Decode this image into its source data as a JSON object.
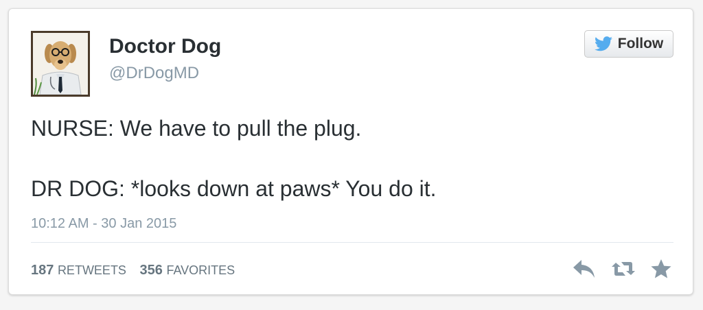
{
  "user": {
    "name": "Doctor Dog",
    "handle": "@DrDogMD"
  },
  "follow_button": {
    "label": "Follow"
  },
  "tweet": {
    "line1": "NURSE: We have to pull the plug.",
    "line2": "DR DOG: *looks down at paws* You do it.",
    "timestamp": "10:12 AM - 30 Jan 2015"
  },
  "stats": {
    "retweets_count": "187",
    "retweets_label": "RETWEETS",
    "favorites_count": "356",
    "favorites_label": "FAVORITES"
  },
  "icons": {
    "follow": "twitter-bird-icon",
    "reply": "reply-icon",
    "retweet": "retweet-icon",
    "favorite": "star-icon"
  },
  "colors": {
    "twitter_blue": "#55acee",
    "text_primary": "#292f33",
    "text_secondary": "#8899a6",
    "action_gray": "#8899a6"
  }
}
